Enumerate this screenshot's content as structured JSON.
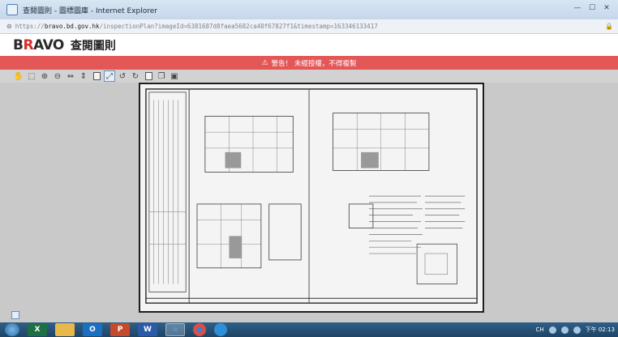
{
  "window": {
    "title": "查閱圖則 - 圖標圖庫 - Internet Explorer",
    "controls": {
      "minimize": "—",
      "maximize": "☐",
      "close": "✕"
    }
  },
  "address": {
    "prefix": "https://",
    "host": "bravo.bd.gov.hk",
    "path": "/inspectionPlan?imageId=6381687d8faea5682ca40f67827f1&timestamp=163346133417"
  },
  "header": {
    "logo_part1": "B",
    "logo_part2": "R",
    "logo_part3": "AVO",
    "title": "查閱圖則"
  },
  "warning": {
    "text": "警告！ 未經授權，不得複製"
  },
  "toolbar": {
    "tools": [
      "pan-icon",
      "select-icon",
      "zoom-in-icon",
      "zoom-out-icon",
      "fit-width-icon",
      "fit-page-icon",
      "actual-size-icon",
      "rotate-left-icon",
      "rotate-right-icon",
      "page-icon",
      "copy-icon",
      "save-icon"
    ]
  },
  "taskbar": {
    "apps": [
      {
        "name": "excel",
        "label": "X",
        "color": "#1d7044"
      },
      {
        "name": "file-explorer",
        "label": "",
        "color": "#e8b84a"
      },
      {
        "name": "outlook",
        "label": "O",
        "color": "#1a6fc2"
      },
      {
        "name": "powerpoint",
        "label": "P",
        "color": "#c54a2a"
      },
      {
        "name": "word",
        "label": "W",
        "color": "#2b5aa8"
      },
      {
        "name": "internet-explorer",
        "label": "e",
        "color": "#3aa0e8"
      },
      {
        "name": "chrome",
        "label": "",
        "color": "#dc4e3d"
      },
      {
        "name": "edge",
        "label": "",
        "color": "#2e8fd8"
      }
    ],
    "lang": "CH",
    "clock_time": "下午 02:13"
  }
}
